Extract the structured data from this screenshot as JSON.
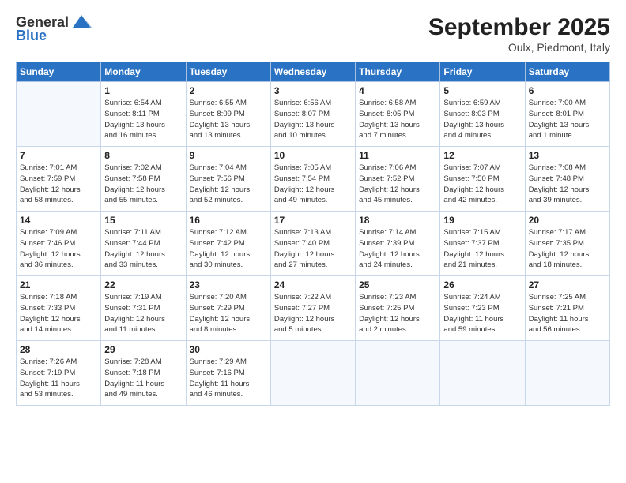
{
  "header": {
    "logo_general": "General",
    "logo_blue": "Blue",
    "title": "September 2025",
    "subtitle": "Oulx, Piedmont, Italy"
  },
  "days_of_week": [
    "Sunday",
    "Monday",
    "Tuesday",
    "Wednesday",
    "Thursday",
    "Friday",
    "Saturday"
  ],
  "weeks": [
    [
      {
        "day": "",
        "info": ""
      },
      {
        "day": "1",
        "info": "Sunrise: 6:54 AM\nSunset: 8:11 PM\nDaylight: 13 hours\nand 16 minutes."
      },
      {
        "day": "2",
        "info": "Sunrise: 6:55 AM\nSunset: 8:09 PM\nDaylight: 13 hours\nand 13 minutes."
      },
      {
        "day": "3",
        "info": "Sunrise: 6:56 AM\nSunset: 8:07 PM\nDaylight: 13 hours\nand 10 minutes."
      },
      {
        "day": "4",
        "info": "Sunrise: 6:58 AM\nSunset: 8:05 PM\nDaylight: 13 hours\nand 7 minutes."
      },
      {
        "day": "5",
        "info": "Sunrise: 6:59 AM\nSunset: 8:03 PM\nDaylight: 13 hours\nand 4 minutes."
      },
      {
        "day": "6",
        "info": "Sunrise: 7:00 AM\nSunset: 8:01 PM\nDaylight: 13 hours\nand 1 minute."
      }
    ],
    [
      {
        "day": "7",
        "info": "Sunrise: 7:01 AM\nSunset: 7:59 PM\nDaylight: 12 hours\nand 58 minutes."
      },
      {
        "day": "8",
        "info": "Sunrise: 7:02 AM\nSunset: 7:58 PM\nDaylight: 12 hours\nand 55 minutes."
      },
      {
        "day": "9",
        "info": "Sunrise: 7:04 AM\nSunset: 7:56 PM\nDaylight: 12 hours\nand 52 minutes."
      },
      {
        "day": "10",
        "info": "Sunrise: 7:05 AM\nSunset: 7:54 PM\nDaylight: 12 hours\nand 49 minutes."
      },
      {
        "day": "11",
        "info": "Sunrise: 7:06 AM\nSunset: 7:52 PM\nDaylight: 12 hours\nand 45 minutes."
      },
      {
        "day": "12",
        "info": "Sunrise: 7:07 AM\nSunset: 7:50 PM\nDaylight: 12 hours\nand 42 minutes."
      },
      {
        "day": "13",
        "info": "Sunrise: 7:08 AM\nSunset: 7:48 PM\nDaylight: 12 hours\nand 39 minutes."
      }
    ],
    [
      {
        "day": "14",
        "info": "Sunrise: 7:09 AM\nSunset: 7:46 PM\nDaylight: 12 hours\nand 36 minutes."
      },
      {
        "day": "15",
        "info": "Sunrise: 7:11 AM\nSunset: 7:44 PM\nDaylight: 12 hours\nand 33 minutes."
      },
      {
        "day": "16",
        "info": "Sunrise: 7:12 AM\nSunset: 7:42 PM\nDaylight: 12 hours\nand 30 minutes."
      },
      {
        "day": "17",
        "info": "Sunrise: 7:13 AM\nSunset: 7:40 PM\nDaylight: 12 hours\nand 27 minutes."
      },
      {
        "day": "18",
        "info": "Sunrise: 7:14 AM\nSunset: 7:39 PM\nDaylight: 12 hours\nand 24 minutes."
      },
      {
        "day": "19",
        "info": "Sunrise: 7:15 AM\nSunset: 7:37 PM\nDaylight: 12 hours\nand 21 minutes."
      },
      {
        "day": "20",
        "info": "Sunrise: 7:17 AM\nSunset: 7:35 PM\nDaylight: 12 hours\nand 18 minutes."
      }
    ],
    [
      {
        "day": "21",
        "info": "Sunrise: 7:18 AM\nSunset: 7:33 PM\nDaylight: 12 hours\nand 14 minutes."
      },
      {
        "day": "22",
        "info": "Sunrise: 7:19 AM\nSunset: 7:31 PM\nDaylight: 12 hours\nand 11 minutes."
      },
      {
        "day": "23",
        "info": "Sunrise: 7:20 AM\nSunset: 7:29 PM\nDaylight: 12 hours\nand 8 minutes."
      },
      {
        "day": "24",
        "info": "Sunrise: 7:22 AM\nSunset: 7:27 PM\nDaylight: 12 hours\nand 5 minutes."
      },
      {
        "day": "25",
        "info": "Sunrise: 7:23 AM\nSunset: 7:25 PM\nDaylight: 12 hours\nand 2 minutes."
      },
      {
        "day": "26",
        "info": "Sunrise: 7:24 AM\nSunset: 7:23 PM\nDaylight: 11 hours\nand 59 minutes."
      },
      {
        "day": "27",
        "info": "Sunrise: 7:25 AM\nSunset: 7:21 PM\nDaylight: 11 hours\nand 56 minutes."
      }
    ],
    [
      {
        "day": "28",
        "info": "Sunrise: 7:26 AM\nSunset: 7:19 PM\nDaylight: 11 hours\nand 53 minutes."
      },
      {
        "day": "29",
        "info": "Sunrise: 7:28 AM\nSunset: 7:18 PM\nDaylight: 11 hours\nand 49 minutes."
      },
      {
        "day": "30",
        "info": "Sunrise: 7:29 AM\nSunset: 7:16 PM\nDaylight: 11 hours\nand 46 minutes."
      },
      {
        "day": "",
        "info": ""
      },
      {
        "day": "",
        "info": ""
      },
      {
        "day": "",
        "info": ""
      },
      {
        "day": "",
        "info": ""
      }
    ]
  ]
}
